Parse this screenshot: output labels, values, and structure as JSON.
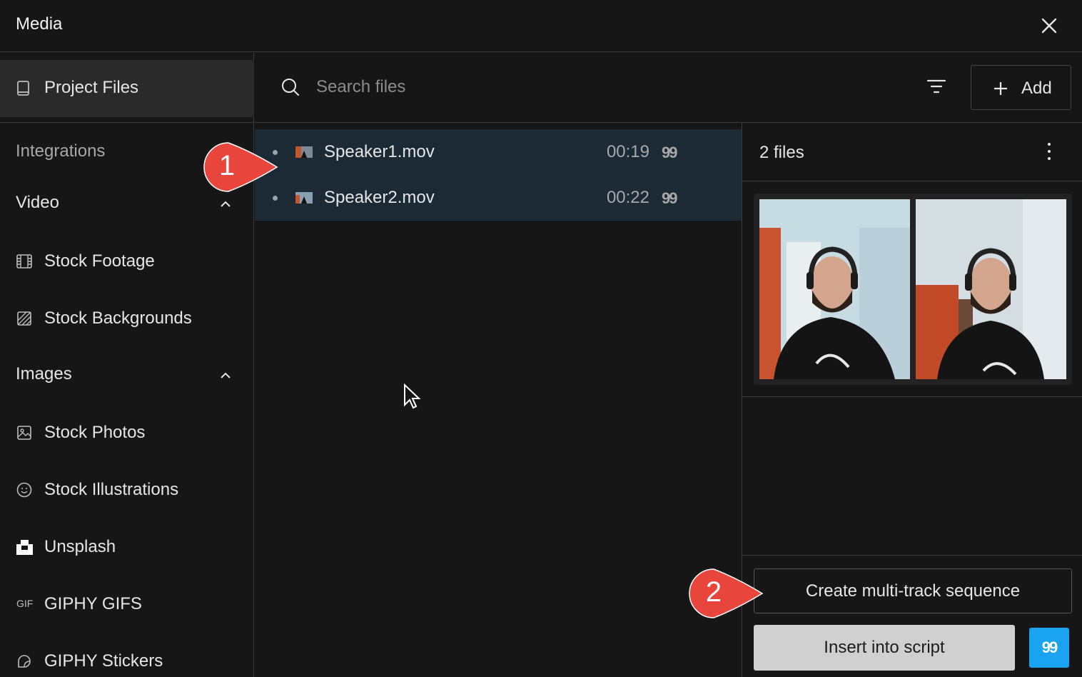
{
  "window": {
    "title": "Media"
  },
  "sidebar": {
    "project_files": "Project Files",
    "integrations_label": "Integrations",
    "sections": [
      {
        "title": "Video",
        "items": [
          "Stock Footage",
          "Stock Backgrounds"
        ]
      },
      {
        "title": "Images",
        "items": [
          "Stock Photos",
          "Stock Illustrations",
          "Unsplash",
          "GIPHY GIFS",
          "GIPHY Stickers"
        ]
      }
    ],
    "gif_icon_text": "GIF"
  },
  "search": {
    "placeholder": "Search files",
    "add_label": "Add"
  },
  "files": [
    {
      "name": "Speaker1.mov",
      "duration": "00:19",
      "quote_icon": "99"
    },
    {
      "name": "Speaker2.mov",
      "duration": "00:22",
      "quote_icon": "99"
    }
  ],
  "selection": {
    "count_label": "2 files"
  },
  "actions": {
    "multitrack_label": "Create multi-track sequence",
    "insert_label": "Insert into script",
    "quote_icon": "99"
  },
  "callouts": [
    "1",
    "2"
  ],
  "colors": {
    "accent": "#1aa3f0",
    "callout": "#e8463c",
    "selected_row": "#1c2a36"
  }
}
